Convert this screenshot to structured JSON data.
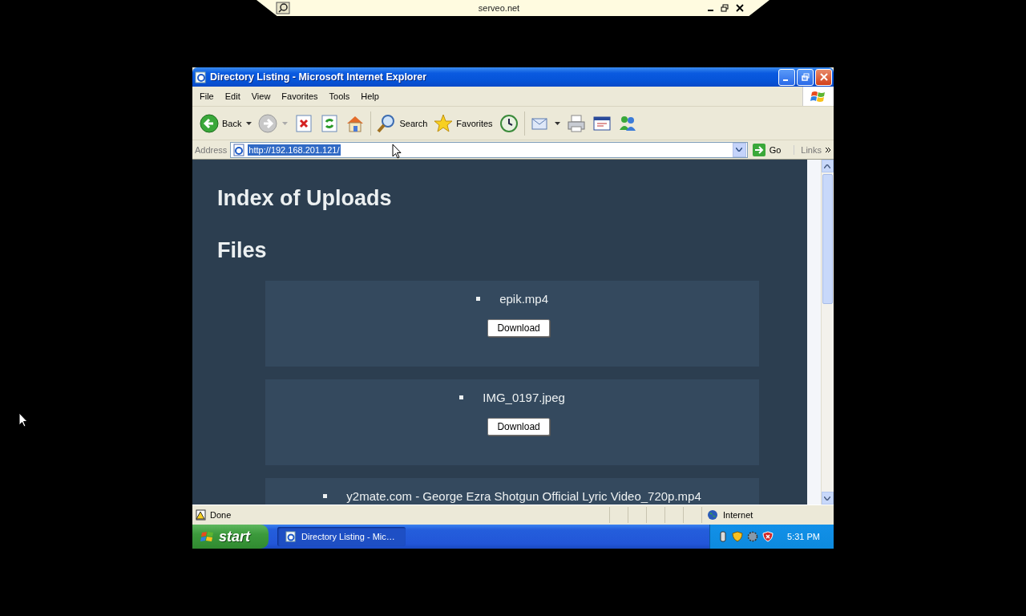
{
  "remote_bar": {
    "title": "serveo.net"
  },
  "window": {
    "title": "Directory Listing - Microsoft Internet Explorer"
  },
  "menu": [
    "File",
    "Edit",
    "View",
    "Favorites",
    "Tools",
    "Help"
  ],
  "toolbar": [
    {
      "kind": "back",
      "label": "Back"
    },
    {
      "kind": "forward"
    },
    {
      "kind": "stop"
    },
    {
      "kind": "refresh"
    },
    {
      "kind": "home"
    },
    {
      "kind": "search",
      "label": "Search"
    },
    {
      "kind": "favorites",
      "label": "Favorites"
    },
    {
      "kind": "history"
    },
    {
      "kind": "mail"
    },
    {
      "kind": "print"
    },
    {
      "kind": "edit"
    },
    {
      "kind": "messenger"
    }
  ],
  "address": {
    "label": "Address",
    "value": "http://192.168.201.121/",
    "selected": true,
    "go": "Go",
    "links": "Links"
  },
  "page": {
    "heading": "Index of Uploads",
    "subheading": "Files",
    "files": [
      {
        "name": "epik.mp4",
        "button": "Download"
      },
      {
        "name": "IMG_0197.jpeg",
        "button": "Download"
      },
      {
        "name": "y2mate.com - George Ezra Shotgun Official Lyric Video_720p.mp4"
      }
    ]
  },
  "status_bar": {
    "text": "Done",
    "zone": "Internet"
  },
  "taskbar": {
    "start": "start",
    "tasks": [
      {
        "label": "Directory Listing - Mic…",
        "selected": true
      }
    ],
    "clock": "5:31 PM"
  }
}
